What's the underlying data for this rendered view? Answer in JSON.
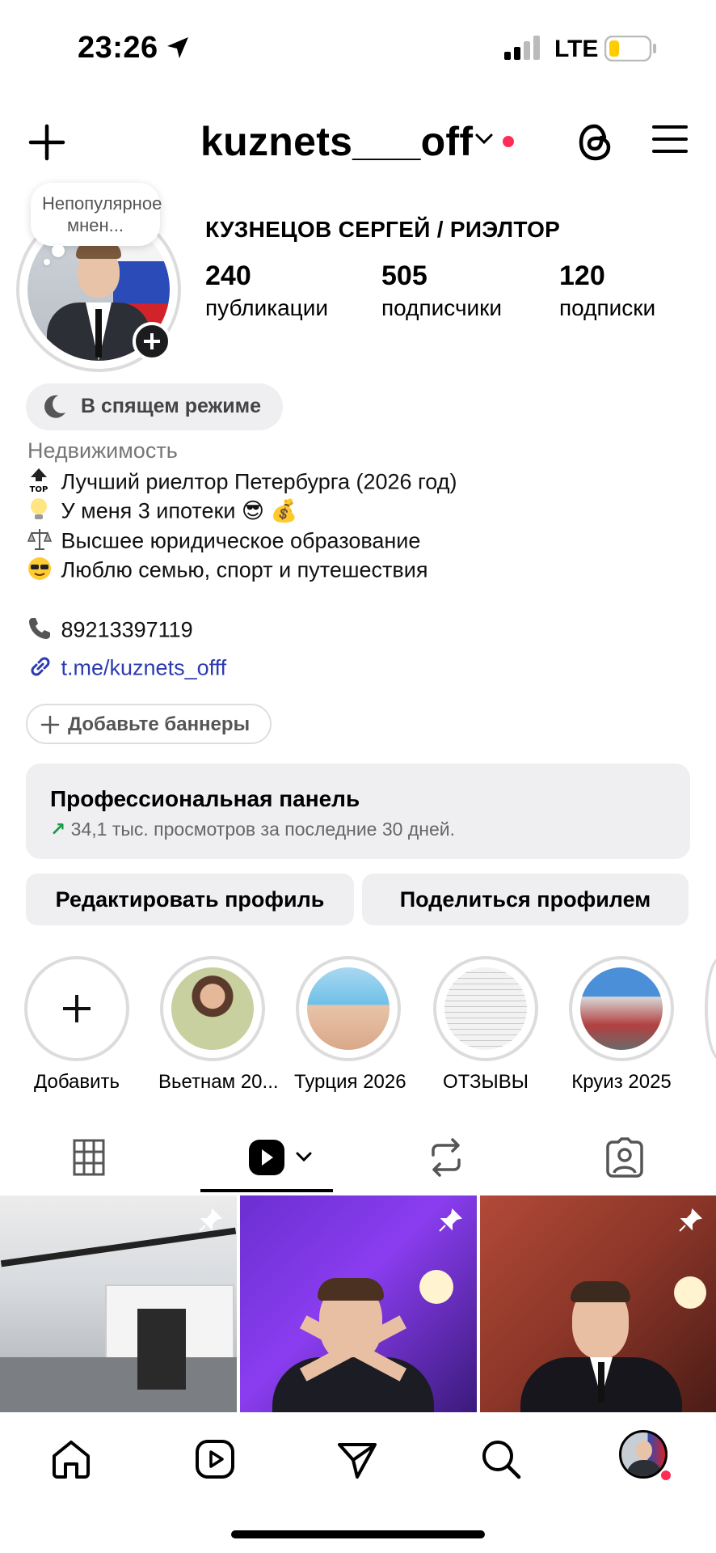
{
  "status_bar": {
    "time": "23:26",
    "network": "LTE",
    "battery_color": "#ffcc00"
  },
  "header": {
    "username": "kuznets___off",
    "dot_color": "#ff2d55"
  },
  "profile": {
    "note": "Непопулярное мнен...",
    "full_name": "КУЗНЕЦОВ СЕРГЕЙ / РИЭЛТОР",
    "stats": [
      {
        "value": "240",
        "label": "публикации"
      },
      {
        "value": "505",
        "label": "подписчики"
      },
      {
        "value": "120",
        "label": "подписки"
      }
    ],
    "sleep_mode": "В спящем режиме",
    "category": "Недвижимость",
    "bio": [
      {
        "icon": "top-arrow-icon",
        "text": "Лучший риелтор Петербурга (2026 год)"
      },
      {
        "icon": "lightbulb-icon",
        "text": "У меня 3 ипотеки 😎 💰"
      },
      {
        "icon": "scales-icon",
        "text": "Высшее юридическое образование"
      },
      {
        "icon": "sunglasses-face-icon",
        "text": "Люблю семью, спорт и путешествия"
      }
    ],
    "phone": "89213397119",
    "link": "t.me/kuznets_offf",
    "link_color": "#2c3bb0"
  },
  "banner": {
    "label": "Добавьте баннеры"
  },
  "pro_panel": {
    "title": "Профессиональная панель",
    "subtitle": "34,1 тыс. просмотров за последние 30 дней."
  },
  "actions": {
    "edit": "Редактировать профиль",
    "share": "Поделиться профилем"
  },
  "highlights": [
    {
      "label": "Добавить"
    },
    {
      "label": "Вьетнам 20..."
    },
    {
      "label": "Турция 2026"
    },
    {
      "label": "ОТЗЫВЫ"
    },
    {
      "label": "Круиз 2025"
    }
  ],
  "tabs": [
    "grid",
    "reels",
    "reposts",
    "tagged"
  ],
  "active_tab": "reels"
}
